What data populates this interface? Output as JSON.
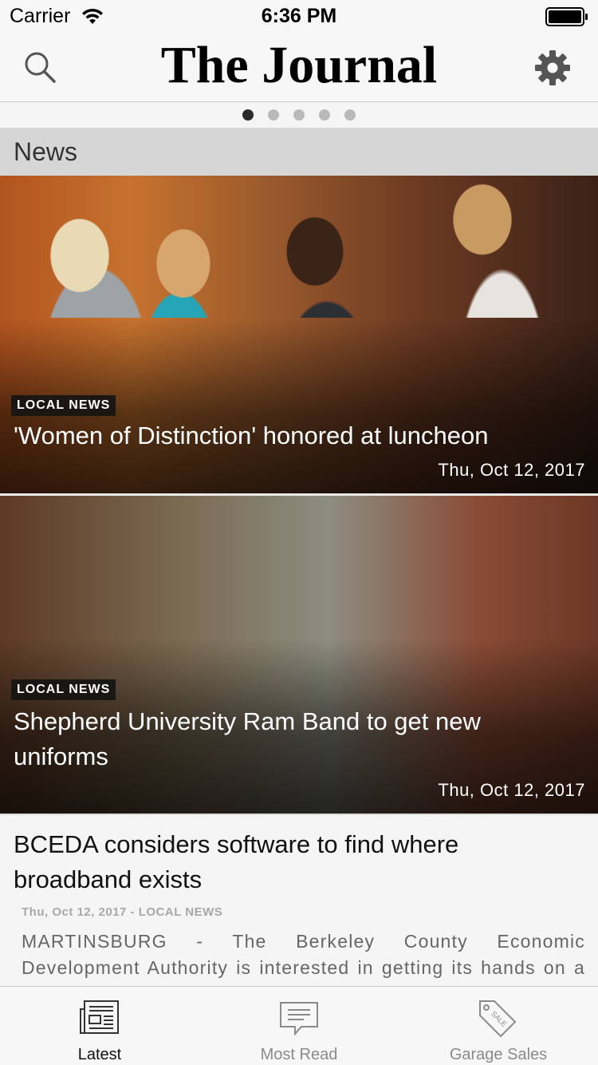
{
  "status_bar": {
    "carrier": "Carrier",
    "time": "6:36 PM"
  },
  "header": {
    "title": "The Journal"
  },
  "pager": {
    "total": 5,
    "active": 1
  },
  "section": {
    "title": "News"
  },
  "featured": [
    {
      "category": "LOCAL NEWS",
      "title": "'Women of Distinction' honored at luncheon",
      "date": "Thu, Oct 12, 2017"
    },
    {
      "category": "LOCAL NEWS",
      "title": "Shepherd University Ram Band to get new uniforms",
      "date": "Thu, Oct 12, 2017"
    }
  ],
  "article": {
    "title": "BCEDA considers software to find where broadband exists",
    "meta": "Thu, Oct 12, 2017 - LOCAL NEWS",
    "excerpt": "MARTINSBURG - The Berkeley County Economic Development Authority is interested in getting its hands on a software program that identifies broadband connectivity in"
  },
  "tabs": [
    {
      "label": "Latest",
      "icon": "newspaper-icon",
      "active": true
    },
    {
      "label": "Most Read",
      "icon": "message-icon",
      "active": false
    },
    {
      "label": "Garage Sales",
      "icon": "sale-tag-icon",
      "active": false
    }
  ]
}
